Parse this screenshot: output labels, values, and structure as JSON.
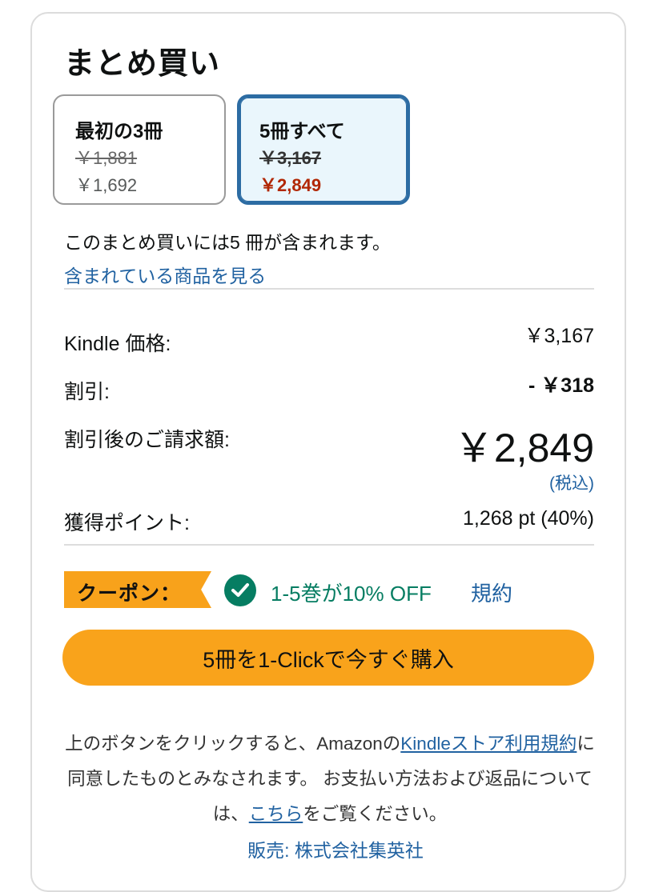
{
  "title": "まとめ買い",
  "options": [
    {
      "name": "最初の3冊",
      "original_price": "￥1,881",
      "price": "￥1,692",
      "selected": false
    },
    {
      "name": "5冊すべて",
      "original_price": "￥3,167",
      "price": "￥2,849",
      "selected": true
    }
  ],
  "contains_text": "このまとめ買いには5 冊が含まれます。",
  "see_items_link": "含まれている商品を見る",
  "summary": {
    "kindle_price_label": "Kindle 価格:",
    "kindle_price_value": "￥3,167",
    "discount_label": "割引:",
    "discount_value": "- ￥318",
    "total_label": "割引後のご請求額:",
    "total_value": "￥2,849",
    "tax_note": "(税込)",
    "points_label": "獲得ポイント:",
    "points_value": "1,268 pt (40%)"
  },
  "coupon": {
    "tag": "クーポン：",
    "offer": "1-5巻が10% OFF",
    "terms_link": "規約"
  },
  "buy_button": "5冊を1-Clickで今すぐ購入",
  "legal": {
    "part1": "上のボタンをクリックすると、Amazonの",
    "link1": "Kindleストア利用規約",
    "part2": "に同意したものとみなされます。 お支払い方法および返品については、",
    "link2": "こちら",
    "part3": "をご覧ください。"
  },
  "seller": "販売: 株式会社集英社",
  "colors": {
    "accent": "#f9a31b",
    "selected_border": "#2c6ca3",
    "price_red": "#b12704",
    "link_blue": "#2162a1",
    "coupon_green": "#067d62"
  },
  "icons": [
    "check-circle-icon"
  ]
}
